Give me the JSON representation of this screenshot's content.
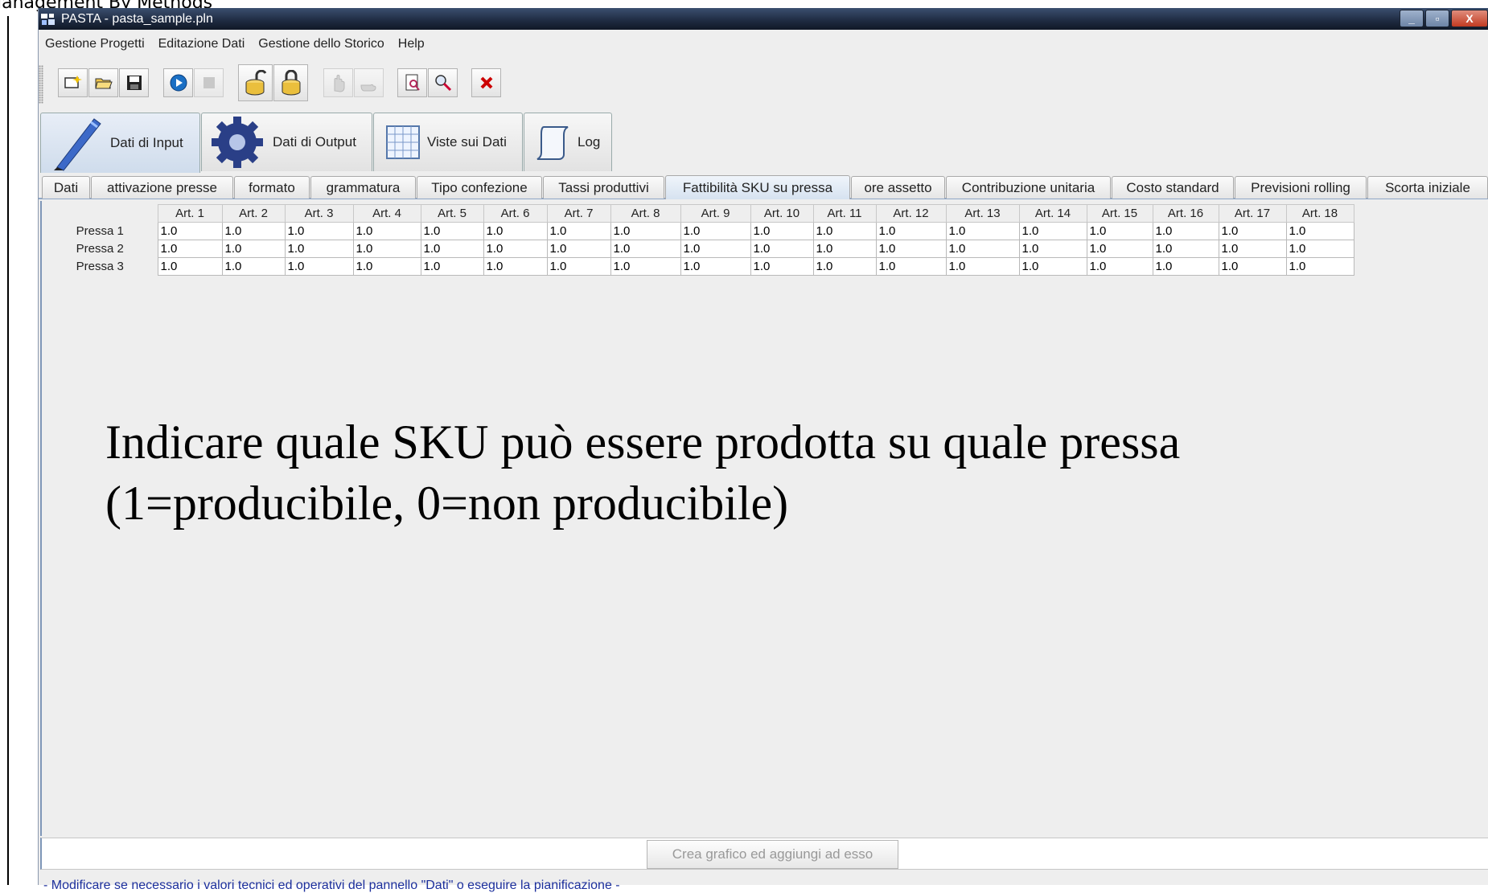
{
  "slide_header": "lanagement By Methods",
  "window": {
    "title": "PASTA - pasta_sample.pln",
    "controls": {
      "minimize": "_",
      "maximize": "▫",
      "close": "X"
    }
  },
  "menu": [
    "Gestione Progetti",
    "Editazione Dati",
    "Gestione dello Storico",
    "Help"
  ],
  "toolbar_icons": [
    "new-project-icon",
    "open-folder-icon",
    "save-icon",
    "play-icon",
    "stop-icon",
    "database-unlock-icon",
    "database-lock-icon",
    "undo-hand-icon",
    "redo-hand-icon",
    "preview-icon",
    "zoom-icon",
    "delete-icon"
  ],
  "main_tabs": [
    {
      "label": "Dati di Input",
      "icon": "pen-icon",
      "active": true
    },
    {
      "label": "Dati di Output",
      "icon": "gear-icon",
      "active": false
    },
    {
      "label": "Viste sui Dati",
      "icon": "table-icon",
      "active": false
    },
    {
      "label": "Log",
      "icon": "scroll-icon",
      "active": false
    }
  ],
  "sub_tabs": [
    {
      "label": "Dati"
    },
    {
      "label": "attivazione presse"
    },
    {
      "label": "formato"
    },
    {
      "label": "grammatura"
    },
    {
      "label": "Tipo confezione"
    },
    {
      "label": "Tassi produttivi"
    },
    {
      "label": "Fattibilità SKU su pressa",
      "active": true
    },
    {
      "label": "ore assetto"
    },
    {
      "label": "Contribuzione unitaria"
    },
    {
      "label": "Costo standard"
    },
    {
      "label": "Previsioni rolling"
    },
    {
      "label": "Scorta iniziale"
    }
  ],
  "table": {
    "columns": [
      "Art. 1",
      "Art. 2",
      "Art. 3",
      "Art. 4",
      "Art. 5",
      "Art. 6",
      "Art. 7",
      "Art. 8",
      "Art. 9",
      "Art. 10",
      "Art. 11",
      "Art. 12",
      "Art. 13",
      "Art. 14",
      "Art. 15",
      "Art. 16",
      "Art. 17",
      "Art. 18"
    ],
    "rows": [
      {
        "label": "Pressa 1",
        "values": [
          "1.0",
          "1.0",
          "1.0",
          "1.0",
          "1.0",
          "1.0",
          "1.0",
          "1.0",
          "1.0",
          "1.0",
          "1.0",
          "1.0",
          "1.0",
          "1.0",
          "1.0",
          "1.0",
          "1.0",
          "1.0"
        ]
      },
      {
        "label": "Pressa 2",
        "values": [
          "1.0",
          "1.0",
          "1.0",
          "1.0",
          "1.0",
          "1.0",
          "1.0",
          "1.0",
          "1.0",
          "1.0",
          "1.0",
          "1.0",
          "1.0",
          "1.0",
          "1.0",
          "1.0",
          "1.0",
          "1.0"
        ]
      },
      {
        "label": "Pressa 3",
        "values": [
          "1.0",
          "1.0",
          "1.0",
          "1.0",
          "1.0",
          "1.0",
          "1.0",
          "1.0",
          "1.0",
          "1.0",
          "1.0",
          "1.0",
          "1.0",
          "1.0",
          "1.0",
          "1.0",
          "1.0",
          "1.0"
        ]
      }
    ]
  },
  "note": {
    "line1": "Indicare quale SKU può essere prodotta su quale pressa",
    "line2": "(1=producibile, 0=non producibile)"
  },
  "chart_button": "Crea grafico ed aggiungi ad esso",
  "status_text": "- Modificare se necessario i valori tecnici ed operativi del pannello \"Dati\" o eseguire la pianificazione -"
}
